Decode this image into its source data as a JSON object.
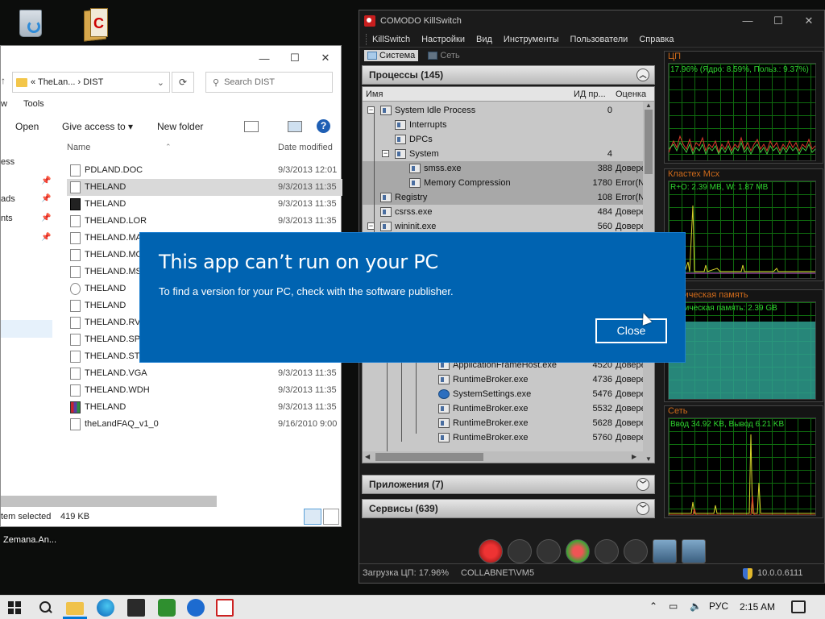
{
  "explorer": {
    "breadcrumb": "« TheLan... › DIST",
    "search_placeholder": "Search DIST",
    "menu_fragment": "w",
    "menu_tools": "Tools",
    "ribbon": {
      "open": "Open",
      "give_access": "Give access to ▾",
      "new_folder": "New folder"
    },
    "col_name": "Name",
    "col_date": "Date modified",
    "nav_items": [
      "ess",
      "ads",
      "nts"
    ],
    "files": [
      {
        "name": "PDLAND.DOC",
        "date": "9/3/2013 12:01"
      },
      {
        "name": "THELAND",
        "date": "9/3/2013 11:35"
      },
      {
        "name": "THELAND",
        "date": "9/3/2013 11:35"
      },
      {
        "name": "THELAND.LOR",
        "date": "9/3/2013 11:35"
      },
      {
        "name": "THELAND.MAP",
        "date": "9/3/2013 11:35"
      },
      {
        "name": "THELAND.MON",
        "date": "9/3/2013 11:35"
      },
      {
        "name": "THELAND.MSG",
        "date": "9/3/2013 11:35"
      },
      {
        "name": "THELAND",
        "date": "9/3/2013 11:35"
      },
      {
        "name": "THELAND",
        "date": "9/3/2013 11:35"
      },
      {
        "name": "THELAND.RVL",
        "date": "9/3/2013 11:35"
      },
      {
        "name": "THELAND.SPL",
        "date": "9/3/2013 11:35"
      },
      {
        "name": "THELAND.STN",
        "date": "9/3/2013 11:35"
      },
      {
        "name": "THELAND.VGA",
        "date": "9/3/2013 11:35"
      },
      {
        "name": "THELAND.WDH",
        "date": "9/3/2013 11:35"
      },
      {
        "name": "THELAND",
        "date": "9/3/2013 11:35"
      },
      {
        "name": "theLandFAQ_v1_0",
        "date": "9/16/2010 9:00"
      }
    ],
    "status_selected": "tem selected",
    "status_size": "419 KB"
  },
  "desktop": {
    "zemana_label": "Zemana.An..."
  },
  "killswitch": {
    "title": "COMODO KillSwitch",
    "menu": [
      "KillSwitch",
      "Настройки",
      "Вид",
      "Инструменты",
      "Пользователи",
      "Справка"
    ],
    "tabs": [
      "Система",
      "Сеть"
    ],
    "processes_header": "Процессы (145)",
    "col_name": "Имя",
    "col_pid": "ИД пр...",
    "col_rating": "Оценка",
    "processes": [
      {
        "name": "System Idle Process",
        "pid": "0",
        "rating": ""
      },
      {
        "name": "Interrupts",
        "pid": "",
        "rating": ""
      },
      {
        "name": "DPCs",
        "pid": "",
        "rating": ""
      },
      {
        "name": "System",
        "pid": "4",
        "rating": ""
      },
      {
        "name": "smss.exe",
        "pid": "388",
        "rating": "Довере"
      },
      {
        "name": "Memory Compression",
        "pid": "1780",
        "rating": "Error(N"
      },
      {
        "name": "Registry",
        "pid": "108",
        "rating": "Error(N"
      },
      {
        "name": "csrss.exe",
        "pid": "484",
        "rating": "Довере"
      },
      {
        "name": "wininit.exe",
        "pid": "560",
        "rating": "Довере"
      }
    ],
    "processes_lower": [
      {
        "name": "ApplicationFrameHost.exe",
        "pid": "4520",
        "rating": "Довере"
      },
      {
        "name": "RuntimeBroker.exe",
        "pid": "4736",
        "rating": "Довере"
      },
      {
        "name": "SystemSettings.exe",
        "pid": "5476",
        "rating": "Довере"
      },
      {
        "name": "RuntimeBroker.exe",
        "pid": "5532",
        "rating": "Довере"
      },
      {
        "name": "RuntimeBroker.exe",
        "pid": "5628",
        "rating": "Довере"
      },
      {
        "name": "RuntimeBroker.exe",
        "pid": "5760",
        "rating": "Довере"
      }
    ],
    "apps_header": "Приложения (7)",
    "services_header": "Сервисы (639)",
    "graphs": [
      {
        "title": "ЦП",
        "label": "17.96% (Ядро: 8.59%, Польз.: 9.37%)"
      },
      {
        "title": "Кластех Мсх",
        "label": "R+O: 2.39 MB, W: 1.87 MB"
      },
      {
        "title": "Физическая память",
        "label": "Физическая память: 2.39 GB"
      },
      {
        "title": "Сеть",
        "label": "Ввод 34.92 KB, Вывод 6.21 KB"
      }
    ],
    "status_cpu": "Загрузка ЦП: 17.96%",
    "status_host": "COLLABNET\\VM5",
    "version": "10.0.0.6111"
  },
  "dialog": {
    "title": "This app can’t run on your PC",
    "message": "To find a version for your PC, check with the software publisher.",
    "close_label": "Close"
  },
  "taskbar": {
    "language": "РУС",
    "time": "2:15 AM"
  },
  "colors": {
    "dialog_bg": "#0063b1",
    "graph_line": "#2fd42f",
    "graph_title": "#d06b1b"
  }
}
